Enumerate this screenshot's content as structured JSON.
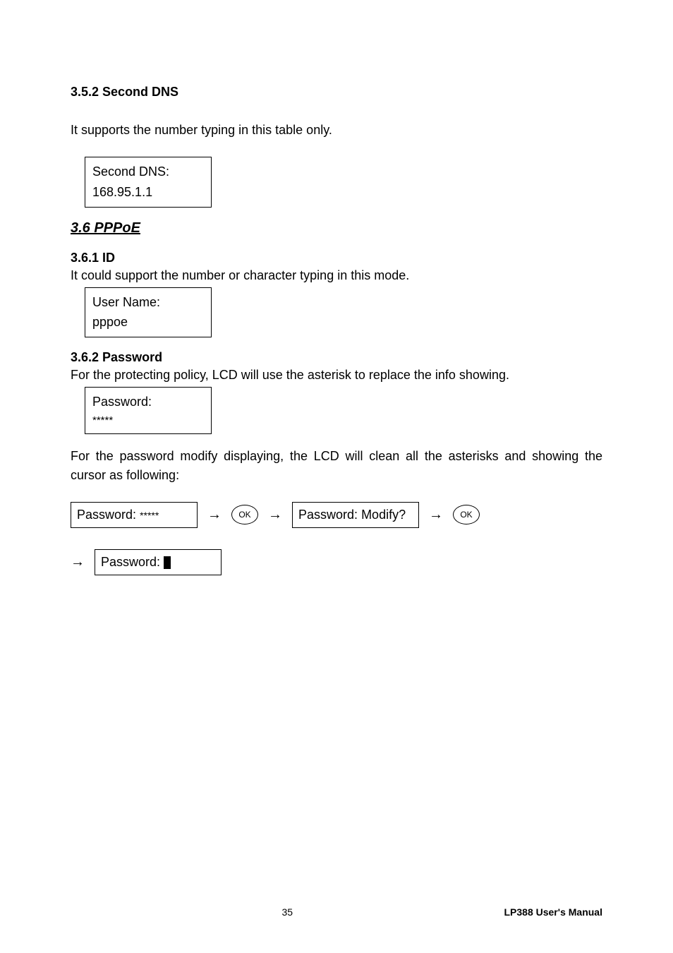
{
  "s352": {
    "heading": "3.5.2 Second DNS",
    "body": "It supports the number typing in this table only.",
    "lcd_line1": "Second DNS:",
    "lcd_line2": "168.95.1.1"
  },
  "s36": {
    "title": "3.6 PPPoE"
  },
  "s361": {
    "heading": "3.6.1 ID",
    "body": "It could support the number or character typing in this mode.",
    "lcd_line1": "User Name:",
    "lcd_line2": "pppoe"
  },
  "s362": {
    "heading": "3.6.2 Password",
    "body1": "For the protecting policy, LCD will use the asterisk to replace the info showing.",
    "lcd1_line1": "Password:",
    "lcd1_line2": "*****",
    "body2": "For the password modify displaying, the LCD will clean all the asterisks and showing the cursor as following:",
    "flow1_line1": "Password:",
    "flow1_line2": "*****",
    "ok_label": "OK",
    "flow2_line1": "Password:",
    "flow2_line2": "Modify?",
    "flow3_line1": "Password:"
  },
  "footer": {
    "page": "35",
    "doc": "LP388  User's  Manual"
  }
}
